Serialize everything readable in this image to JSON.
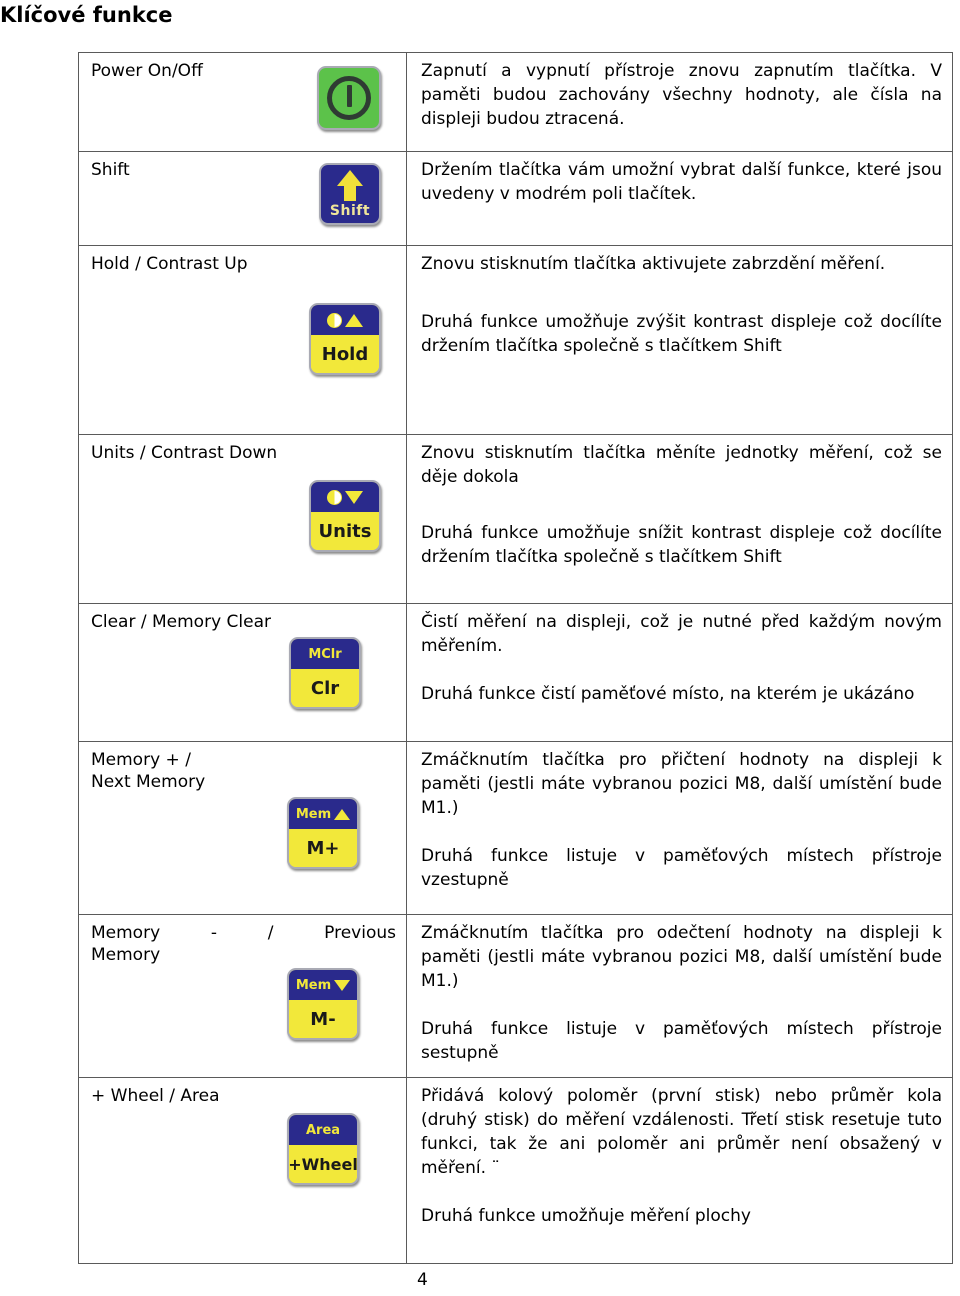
{
  "document": {
    "title": "Klíčové funkce",
    "page_number": "4"
  },
  "rows": [
    {
      "label": "Power On/Off",
      "button": {
        "kind": "power",
        "icon": "power-symbol-icon"
      },
      "paragraphs": [
        "Zapnutí a vypnutí přístroje znovu zapnutím tlačítka. V paměti budou zachovány všechny hodnoty, ale čísla na displeji budou ztracená."
      ]
    },
    {
      "label": "Shift",
      "button": {
        "kind": "shift",
        "top_icon": "arrow-up-icon",
        "word": "Shift"
      },
      "paragraphs": [
        "Držením tlačítka vám umožní vybrat další funkce, které jsou uvedeny v modrém poli tlačítek."
      ]
    },
    {
      "label": "Hold / Contrast Up",
      "button": {
        "kind": "two-tone",
        "top_icon": "contrast-up-icon",
        "top_word": "",
        "bottom_word": "Hold"
      },
      "paragraphs": [
        "Znovu stisknutím tlačítka aktivujete zabrzdění měření.",
        "Druhá funkce umožňuje zvýšit kontrast displeje což docílíte držením tlačítka společně s tlačítkem Shift"
      ]
    },
    {
      "label": "Units / Contrast Down",
      "button": {
        "kind": "two-tone",
        "top_icon": "contrast-down-icon",
        "top_word": "",
        "bottom_word": "Units"
      },
      "paragraphs": [
        "Znovu stisknutím tlačítka měníte jednotky měření, což se děje dokola",
        "Druhá funkce umožňuje snížit kontrast displeje což docílíte držením tlačítka společně s tlačítkem Shift"
      ]
    },
    {
      "label": "Clear / Memory Clear",
      "button": {
        "kind": "two-tone",
        "top_icon": "",
        "top_word": "MClr",
        "bottom_word": "Clr"
      },
      "paragraphs": [
        "Čistí měření na displeji, což je nutné před každým novým měřením.",
        "Druhá funkce čistí paměťové místo, na kterém je ukázáno"
      ]
    },
    {
      "label": "Memory + /\nNext Memory",
      "label_lines": [
        "Memory + /",
        "Next Memory"
      ],
      "button": {
        "kind": "two-tone",
        "top_icon": "arrow-up-small-icon",
        "top_word": "Mem",
        "bottom_word": "M+"
      },
      "paragraphs": [
        "Zmáčknutím tlačítka pro přičtení hodnoty na displeji k paměti (jestli máte vybranou pozici M8, další umístění bude M1.)",
        "Druhá funkce listuje v paměťových místech přístroje vzestupně"
      ]
    },
    {
      "label": "Memory - / Previous Memory",
      "label_lines": [
        "Memory - / Previous",
        "Memory"
      ],
      "button": {
        "kind": "two-tone",
        "top_icon": "arrow-down-small-icon",
        "top_word": "Mem",
        "bottom_word": "M-"
      },
      "paragraphs": [
        "Zmáčknutím tlačítka pro odečtení hodnoty na displeji k paměti (jestli máte vybranou pozici M8, další umístění bude M1.)",
        "Druhá funkce listuje v paměťových místech přístroje sestupně"
      ]
    },
    {
      "label": "+ Wheel / Area",
      "button": {
        "kind": "two-tone",
        "top_icon": "",
        "top_word": "Area",
        "bottom_word": "+Wheel"
      },
      "paragraphs": [
        "Přidává kolový poloměr (první stisk) nebo průměr kola (druhý stisk) do měření vzdálenosti. Třetí stisk resetuje tuto funkci, tak že ani poloměr ani průměr není obsažený v měření. ¨",
        "Druhá funkce umožňuje měření plochy"
      ]
    }
  ],
  "colors": {
    "power_green": "#5cc24a",
    "button_blue": "#2a2a8c",
    "button_yellow": "#f2e83a",
    "border_gray": "#5a5a5a"
  }
}
